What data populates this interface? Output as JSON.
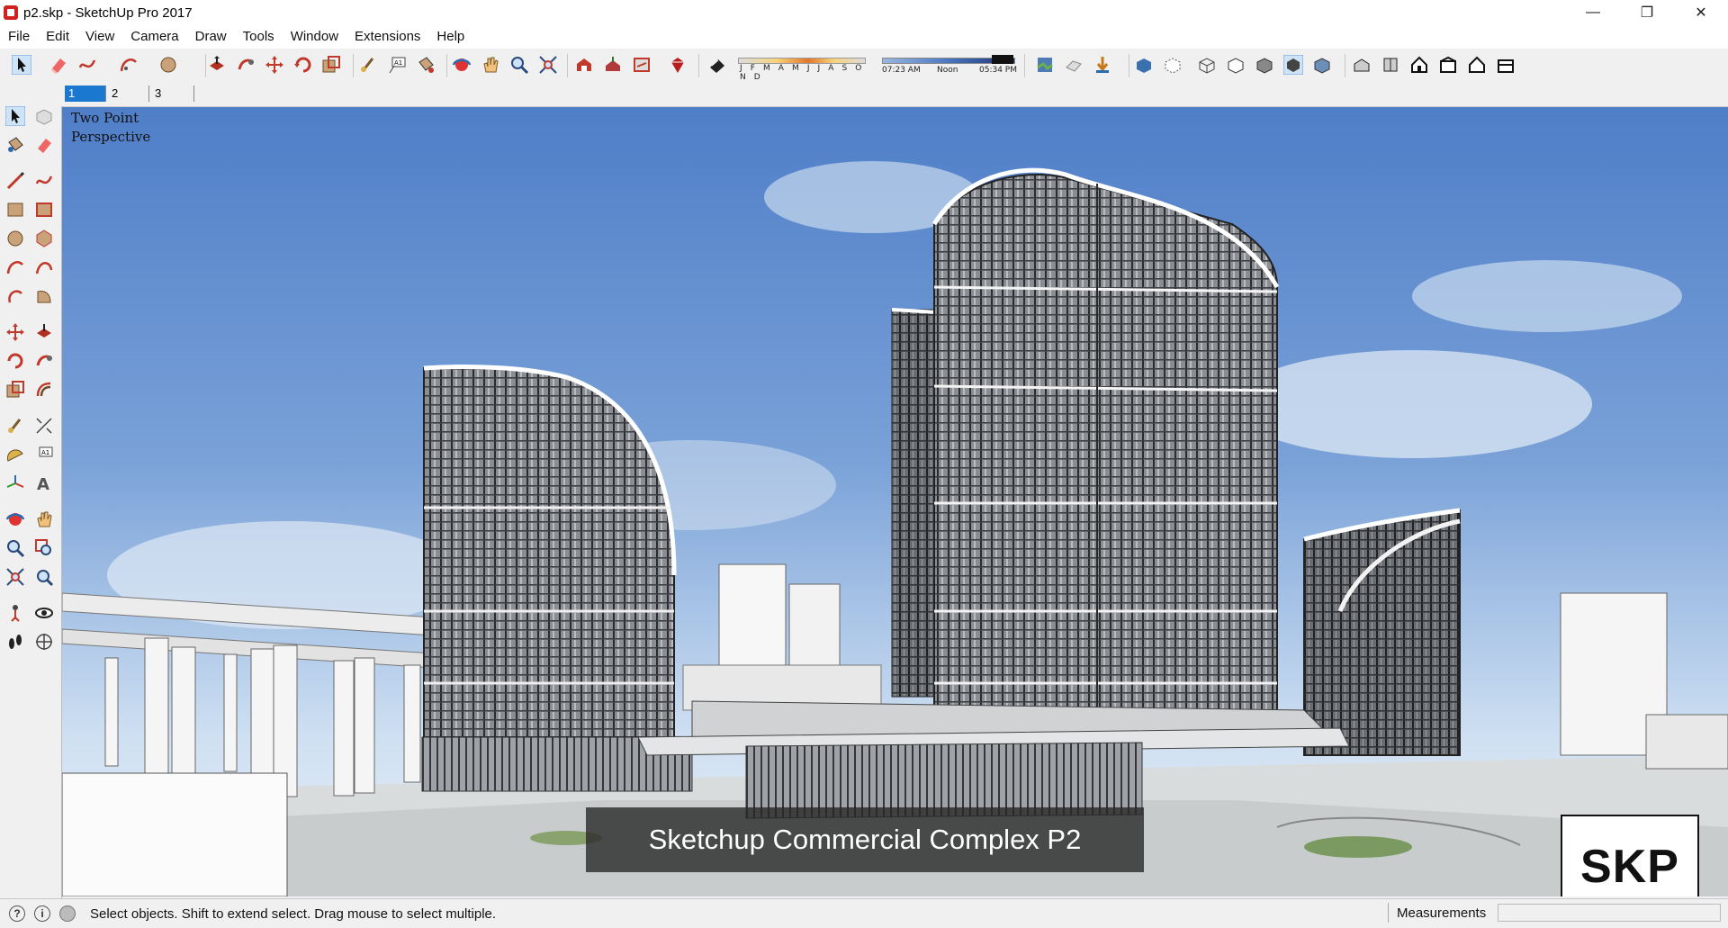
{
  "window": {
    "title": "p2.skp - SketchUp Pro 2017",
    "minimize": "—",
    "maximize": "❐",
    "close": "✕"
  },
  "menu": [
    "File",
    "Edit",
    "View",
    "Camera",
    "Draw",
    "Tools",
    "Window",
    "Extensions",
    "Help"
  ],
  "shadows": {
    "months": "J F M A M J J A S O N D",
    "time_start": "07:23 AM",
    "time_mid": "Noon",
    "time_end": "05:34 PM"
  },
  "scene_tabs": [
    "1",
    "2",
    "3"
  ],
  "active_scene": "1",
  "viewport": {
    "camera_label_line1": "Two Point",
    "camera_label_line2": "Perspective",
    "caption": "Sketchup Commercial Complex P2",
    "logo": "SKP"
  },
  "status": {
    "hint": "Select objects. Shift to extend select. Drag mouse to select multiple.",
    "measurements_label": "Measurements",
    "measurements_value": ""
  },
  "colors": {
    "sky_top": "#4f7ec8",
    "sky_bottom": "#cfe0f2",
    "active_tab": "#1a78d0",
    "tool_red": "#c0392b"
  }
}
